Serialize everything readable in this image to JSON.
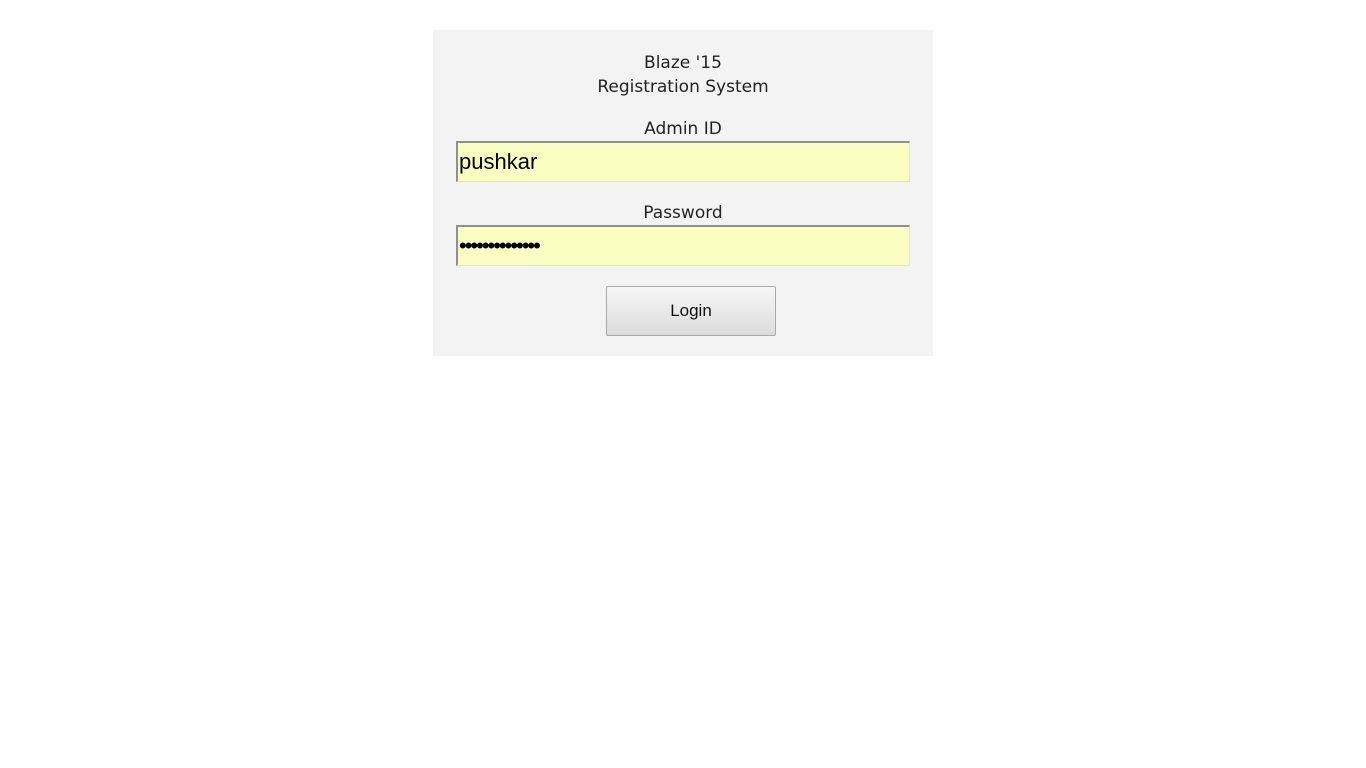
{
  "header": {
    "title_line1": "Blaze '15",
    "title_line2": "Registration System"
  },
  "form": {
    "admin_id": {
      "label": "Admin ID",
      "value": "pushkar"
    },
    "password": {
      "label": "Password",
      "value": "••••••••••••••"
    },
    "login_label": "Login"
  },
  "colors": {
    "panel_background": "#f3f3f3",
    "input_background": "#fafec0"
  }
}
